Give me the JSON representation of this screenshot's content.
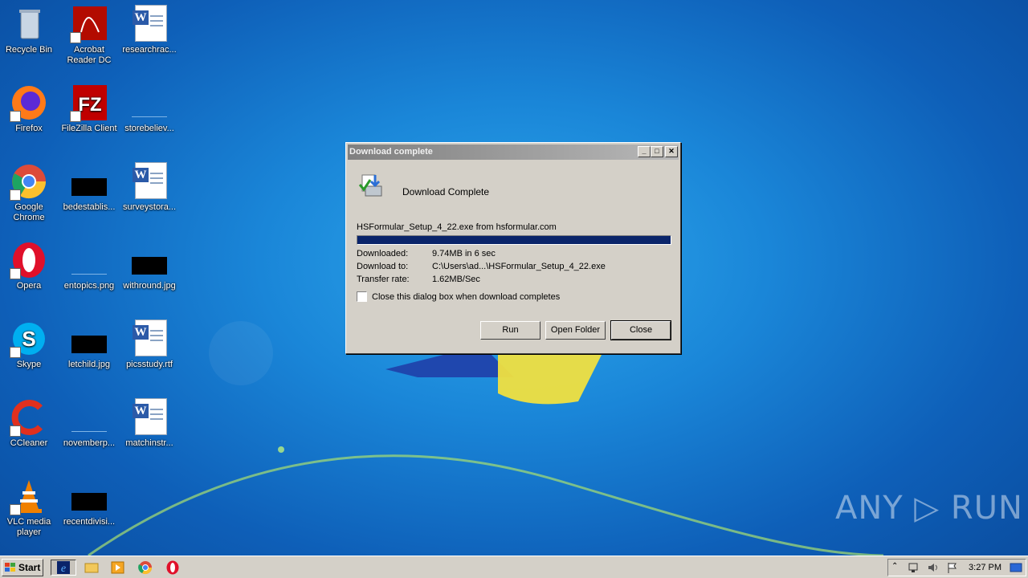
{
  "desktop": {
    "icons": [
      {
        "label": "Recycle Bin"
      },
      {
        "label": "Acrobat Reader DC"
      },
      {
        "label": "researchrac..."
      },
      {
        "label": "Firefox"
      },
      {
        "label": "FileZilla Client"
      },
      {
        "label": "storebeliev..."
      },
      {
        "label": "Google Chrome"
      },
      {
        "label": "bedestablis..."
      },
      {
        "label": "surveystora..."
      },
      {
        "label": "Opera"
      },
      {
        "label": "entopics.png"
      },
      {
        "label": "withround.jpg"
      },
      {
        "label": "Skype"
      },
      {
        "label": "letchild.jpg"
      },
      {
        "label": "picsstudy.rtf"
      },
      {
        "label": "CCleaner"
      },
      {
        "label": "novemberp..."
      },
      {
        "label": "matchinstr..."
      },
      {
        "label": "VLC media player"
      },
      {
        "label": "recentdivisi..."
      }
    ]
  },
  "dialog": {
    "title": "Download complete",
    "heading": "Download Complete",
    "file_line": "HSFormular_Setup_4_22.exe from hsformular.com",
    "progress_percent": 100,
    "downloaded_label": "Downloaded:",
    "downloaded_value": "9.74MB in 6 sec",
    "download_to_label": "Download to:",
    "download_to_value": "C:\\Users\\ad...\\HSFormular_Setup_4_22.exe",
    "transfer_rate_label": "Transfer rate:",
    "transfer_rate_value": "1.62MB/Sec",
    "checkbox_label": "Close this dialog box when download completes",
    "checkbox_checked": false,
    "run_label": "Run",
    "open_folder_label": "Open Folder",
    "close_label": "Close"
  },
  "taskbar": {
    "start_label": "Start",
    "clock": "3:27 PM"
  },
  "watermark": "ANY ▷ RUN"
}
